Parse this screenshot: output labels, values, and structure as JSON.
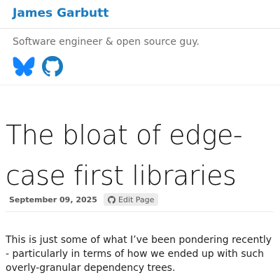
{
  "header": {
    "site_title": "James Garbutt"
  },
  "profile": {
    "tagline": "Software engineer & open source guy.",
    "social": [
      {
        "icon": "bluesky-icon",
        "color": "#1185fe"
      },
      {
        "icon": "github-icon",
        "color": "#1a7bbf"
      }
    ]
  },
  "post": {
    "title": "The bloat of edge-case first libraries",
    "date": "September 09, 2025",
    "edit_label": "Edit Page",
    "intro": "This is just some of what I’ve been pondering recently - particularly in terms of how we ended up with such overly-granular dependency trees."
  },
  "colors": {
    "accent": "#1a7bbf",
    "text": "#222222",
    "muted": "#6f6f6f",
    "badge_bg": "#ececec"
  }
}
